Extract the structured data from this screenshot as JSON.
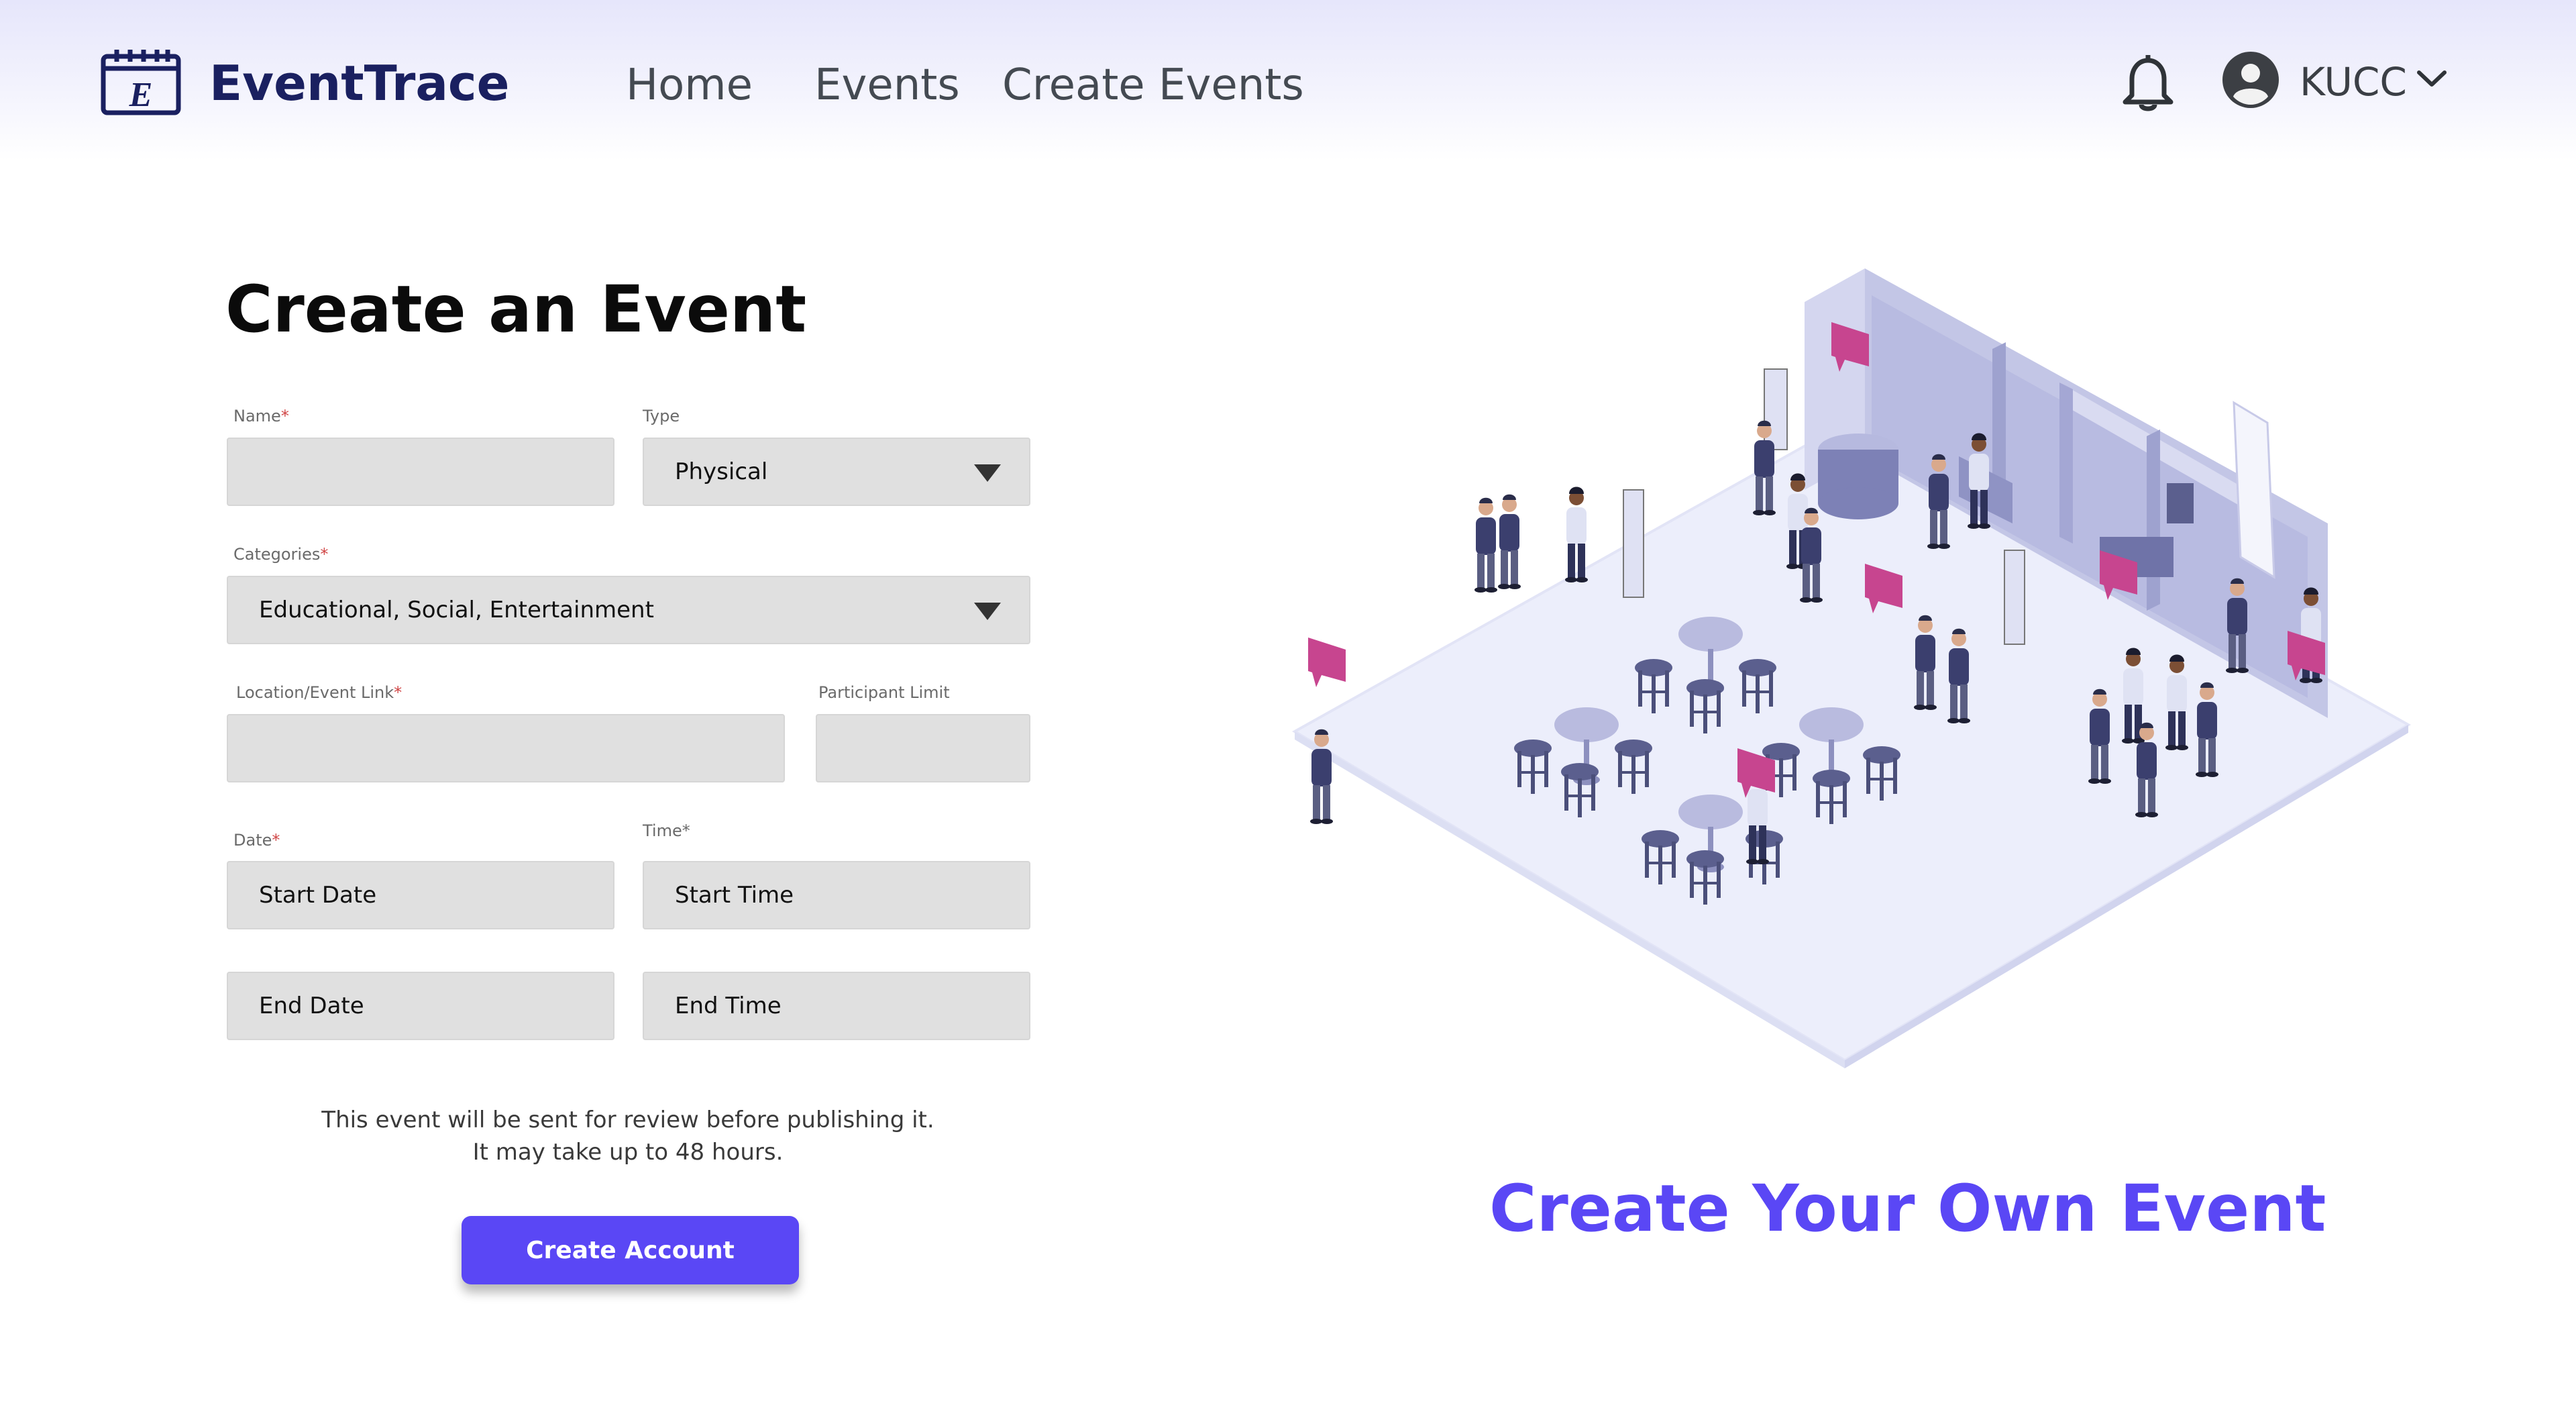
{
  "header": {
    "brand": "EventTrace",
    "logo_letter": "E",
    "nav": [
      "Home",
      "Events",
      "Create Events"
    ],
    "user": "KUCC",
    "icons": {
      "logo": "calendar-icon",
      "notifications": "bell-icon",
      "avatar": "user-circle-icon",
      "menu": "chevron-down-icon"
    }
  },
  "form": {
    "title": "Create an Event",
    "name": {
      "label": "Name",
      "required": "*",
      "value": ""
    },
    "type": {
      "label": "Type",
      "value": "Physical"
    },
    "categories": {
      "label": "Categories",
      "required": "*",
      "value": "Educational, Social, Entertainment"
    },
    "location": {
      "label": "Location/Event Link",
      "required": "*",
      "value": ""
    },
    "participant_limit": {
      "label": "Participant Limit",
      "value": ""
    },
    "date": {
      "label": "Date",
      "required": "*",
      "start_placeholder": "Start Date",
      "end_placeholder": "End Date"
    },
    "time": {
      "label": "Time*",
      "start_placeholder": "Start Time",
      "end_placeholder": "End Time"
    },
    "note_line1": "This event will be sent for review before publishing it.",
    "note_line2": "It may take up to 48 hours.",
    "submit_label": "Create Account"
  },
  "promo": {
    "heading": "Create Your Own Event"
  },
  "colors": {
    "accent": "#5a47f5",
    "brand": "#1a2060",
    "field_bg": "#e0e0e0",
    "speech_pink": "#c7458f"
  }
}
